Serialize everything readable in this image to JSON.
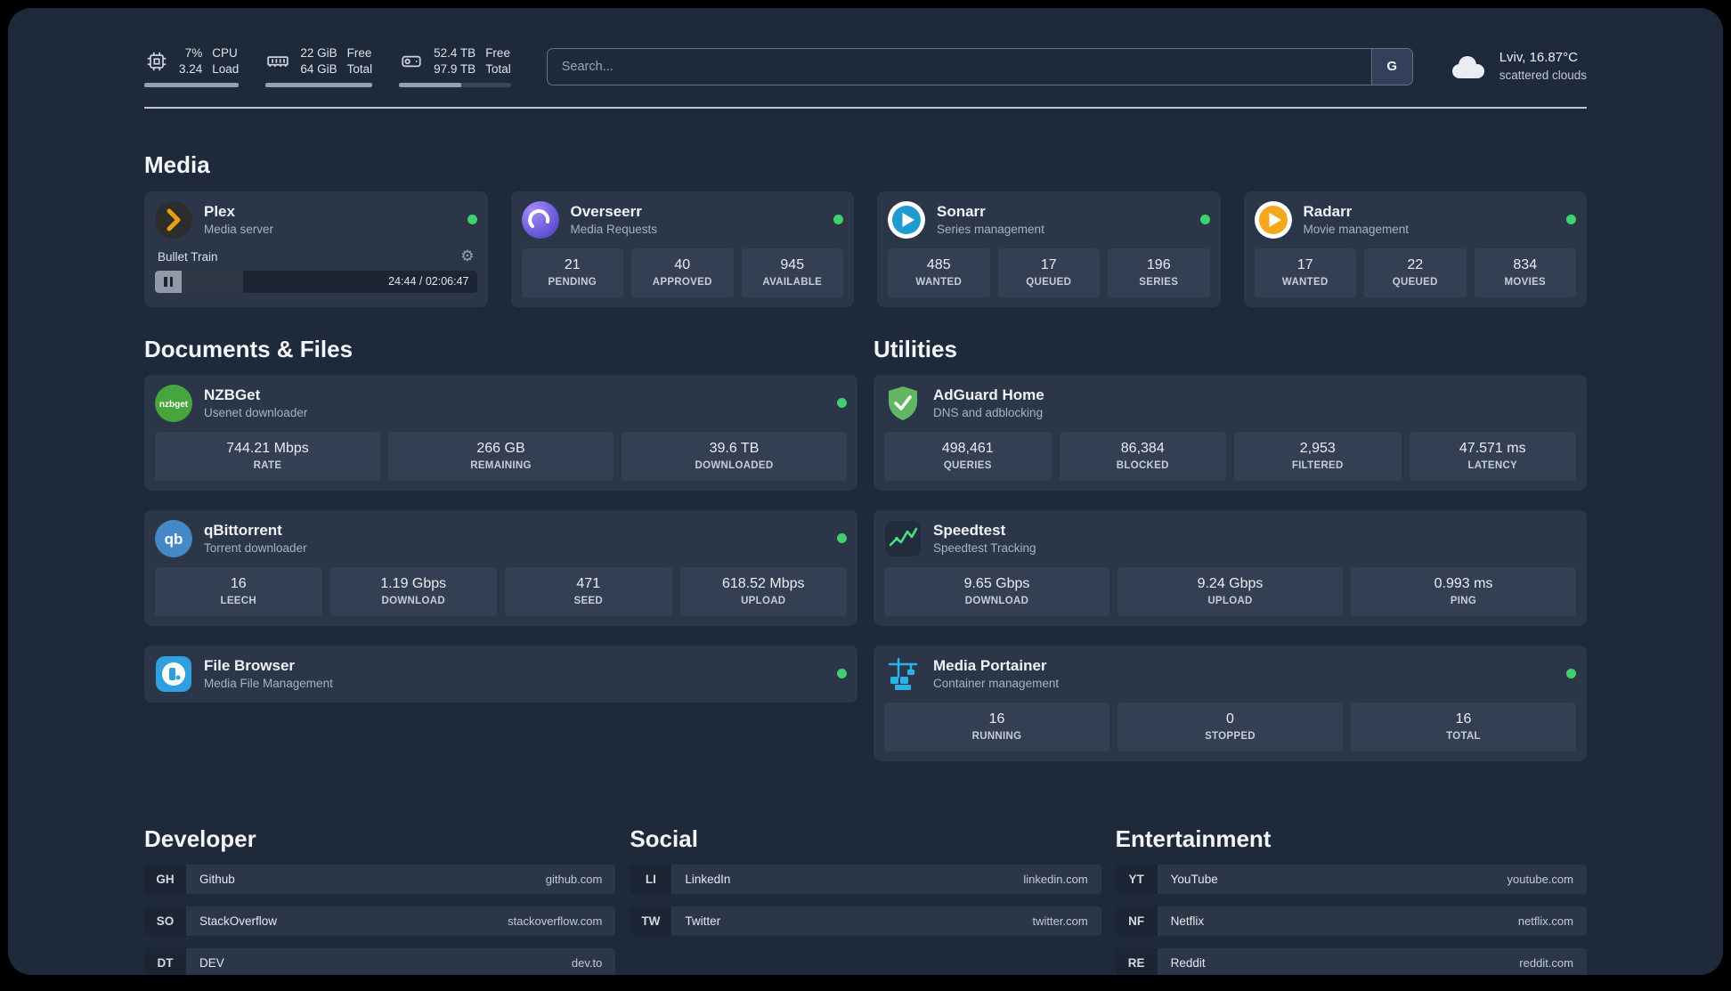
{
  "icons": {
    "settings_gear": "⚙"
  },
  "topbar": {
    "cpu": {
      "value_top": "7%",
      "value_bottom": "3.24",
      "label_top": "CPU",
      "label_bottom": "Load",
      "progress_percent": 100
    },
    "memory": {
      "value_top": "22 GiB",
      "value_bottom": "64 GiB",
      "label_top": "Free",
      "label_bottom": "Total",
      "progress_percent": 100
    },
    "disk": {
      "value_top": "52.4 TB",
      "value_bottom": "97.9 TB",
      "label_top": "Free",
      "label_bottom": "Total",
      "progress_percent": 56
    },
    "search": {
      "placeholder": "Search...",
      "engine_label": "G"
    },
    "weather": {
      "location": "Lviv, 16.87°C",
      "condition": "scattered clouds"
    }
  },
  "media": {
    "section_title": "Media",
    "plex": {
      "name": "Plex",
      "subtitle": "Media server",
      "now_playing": "Bullet Train",
      "time": "24:44 / 02:06:47",
      "progress_percent": 19
    },
    "overseerr": {
      "name": "Overseerr",
      "subtitle": "Media Requests",
      "stats": [
        {
          "value": "21",
          "label": "PENDING"
        },
        {
          "value": "40",
          "label": "APPROVED"
        },
        {
          "value": "945",
          "label": "AVAILABLE"
        }
      ]
    },
    "sonarr": {
      "name": "Sonarr",
      "subtitle": "Series management",
      "stats": [
        {
          "value": "485",
          "label": "WANTED"
        },
        {
          "value": "17",
          "label": "QUEUED"
        },
        {
          "value": "196",
          "label": "SERIES"
        }
      ]
    },
    "radarr": {
      "name": "Radarr",
      "subtitle": "Movie management",
      "stats": [
        {
          "value": "17",
          "label": "WANTED"
        },
        {
          "value": "22",
          "label": "QUEUED"
        },
        {
          "value": "834",
          "label": "MOVIES"
        }
      ]
    }
  },
  "documents": {
    "section_title": "Documents & Files",
    "nzbget": {
      "name": "NZBGet",
      "subtitle": "Usenet downloader",
      "stats": [
        {
          "value": "744.21 Mbps",
          "label": "RATE"
        },
        {
          "value": "266 GB",
          "label": "REMAINING"
        },
        {
          "value": "39.6 TB",
          "label": "DOWNLOADED"
        }
      ]
    },
    "qbittorrent": {
      "name": "qBittorrent",
      "subtitle": "Torrent downloader",
      "stats": [
        {
          "value": "16",
          "label": "LEECH"
        },
        {
          "value": "1.19 Gbps",
          "label": "DOWNLOAD"
        },
        {
          "value": "471",
          "label": "SEED"
        },
        {
          "value": "618.52 Mbps",
          "label": "UPLOAD"
        }
      ]
    },
    "filebrowser": {
      "name": "File Browser",
      "subtitle": "Media File Management"
    }
  },
  "utilities": {
    "section_title": "Utilities",
    "adguard": {
      "name": "AdGuard Home",
      "subtitle": "DNS and adblocking",
      "stats": [
        {
          "value": "498,461",
          "label": "QUERIES"
        },
        {
          "value": "86,384",
          "label": "BLOCKED"
        },
        {
          "value": "2,953",
          "label": "FILTERED"
        },
        {
          "value": "47.571 ms",
          "label": "LATENCY"
        }
      ]
    },
    "speedtest": {
      "name": "Speedtest",
      "subtitle": "Speedtest Tracking",
      "stats": [
        {
          "value": "9.65 Gbps",
          "label": "DOWNLOAD"
        },
        {
          "value": "9.24 Gbps",
          "label": "UPLOAD"
        },
        {
          "value": "0.993 ms",
          "label": "PING"
        }
      ]
    },
    "portainer": {
      "name": "Media Portainer",
      "subtitle": "Container management",
      "stats": [
        {
          "value": "16",
          "label": "RUNNING"
        },
        {
          "value": "0",
          "label": "STOPPED"
        },
        {
          "value": "16",
          "label": "TOTAL"
        }
      ]
    }
  },
  "bookmarks": {
    "developer": {
      "section_title": "Developer",
      "items": [
        {
          "abbr": "GH",
          "name": "Github",
          "domain": "github.com"
        },
        {
          "abbr": "SO",
          "name": "StackOverflow",
          "domain": "stackoverflow.com"
        },
        {
          "abbr": "DT",
          "name": "DEV",
          "domain": "dev.to"
        }
      ]
    },
    "social": {
      "section_title": "Social",
      "items": [
        {
          "abbr": "LI",
          "name": "LinkedIn",
          "domain": "linkedin.com"
        },
        {
          "abbr": "TW",
          "name": "Twitter",
          "domain": "twitter.com"
        }
      ]
    },
    "entertainment": {
      "section_title": "Entertainment",
      "items": [
        {
          "abbr": "YT",
          "name": "YouTube",
          "domain": "youtube.com"
        },
        {
          "abbr": "NF",
          "name": "Netflix",
          "domain": "netflix.com"
        },
        {
          "abbr": "RE",
          "name": "Reddit",
          "domain": "reddit.com"
        }
      ]
    }
  }
}
